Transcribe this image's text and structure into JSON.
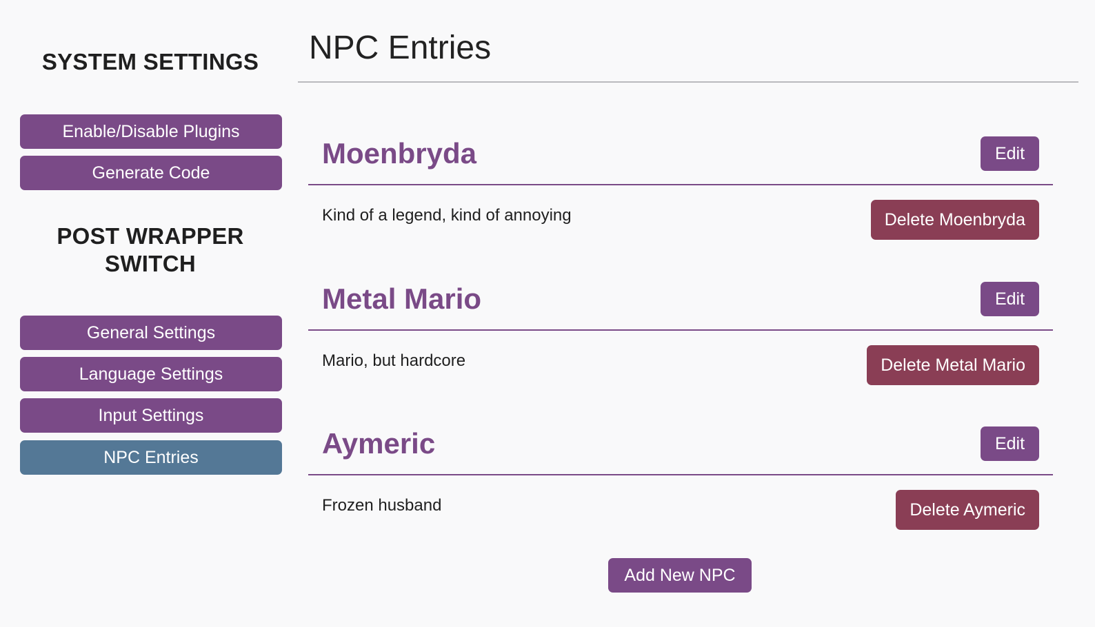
{
  "sidebar": {
    "system_heading": "SYSTEM SETTINGS",
    "system_buttons": [
      "Enable/Disable Plugins",
      "Generate Code"
    ],
    "wrapper_heading_line1": "POST WRAPPER",
    "wrapper_heading_line2": "SWITCH",
    "wrapper_buttons": [
      "General Settings",
      "Language Settings",
      "Input Settings",
      "NPC Entries"
    ],
    "active_item": "NPC Entries"
  },
  "main": {
    "title": "NPC Entries",
    "edit_label": "Edit",
    "npcs": [
      {
        "name": "Moenbryda",
        "description": "Kind of a legend, kind of annoying",
        "delete_label": "Delete Moenbryda"
      },
      {
        "name": "Metal Mario",
        "description": "Mario, but hardcore",
        "delete_label": "Delete Metal Mario"
      },
      {
        "name": "Aymeric",
        "description": "Frozen husband",
        "delete_label": "Delete Aymeric"
      }
    ],
    "add_label": "Add New NPC"
  },
  "colors": {
    "background": "#f9f9fa",
    "primary_purple": "#7a4a87",
    "active_blue": "#547896",
    "delete_red": "#8a3e55",
    "title_rule": "#b9b9bd"
  }
}
